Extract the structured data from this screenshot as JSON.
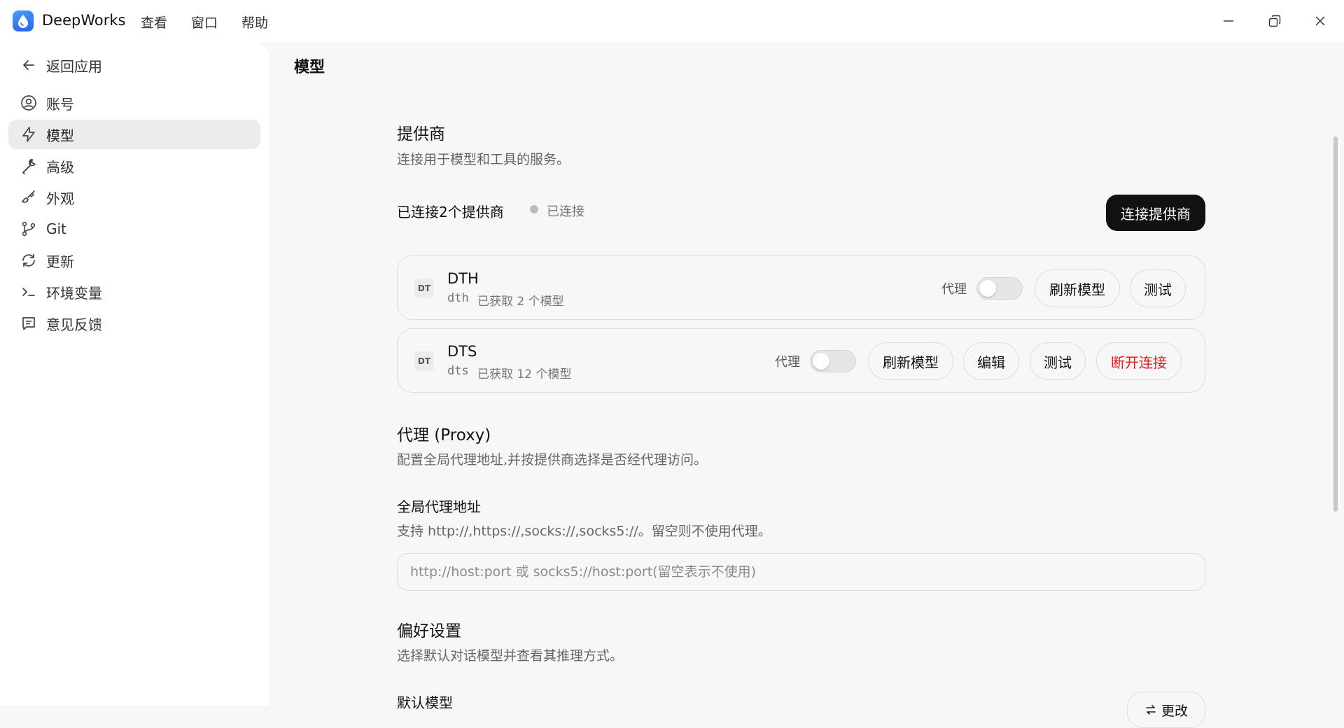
{
  "app": {
    "name": "DeepWorks",
    "menus": [
      "查看",
      "窗口",
      "帮助"
    ]
  },
  "sidebar": {
    "back_label": "返回应用",
    "items": [
      {
        "label": "账号",
        "icon": "user-circle-icon"
      },
      {
        "label": "模型",
        "icon": "lightning-icon",
        "active": true
      },
      {
        "label": "高级",
        "icon": "wrench-icon"
      },
      {
        "label": "外观",
        "icon": "brush-icon"
      },
      {
        "label": "Git",
        "icon": "git-branch-icon"
      },
      {
        "label": "更新",
        "icon": "refresh-icon"
      },
      {
        "label": "环境变量",
        "icon": "terminal-icon"
      },
      {
        "label": "意见反馈",
        "icon": "feedback-icon"
      }
    ]
  },
  "main": {
    "page_title": "模型",
    "providers": {
      "title": "提供商",
      "description": "连接用于模型和工具的服务。",
      "connected_count_label": "已连接2个提供商",
      "status_label": "已连接",
      "connect_button": "连接提供商",
      "list": [
        {
          "badge": "DT",
          "name": "DTH",
          "id": "dth",
          "models_info": "已获取 2 个模型",
          "proxy_label": "代理",
          "proxy_enabled": false,
          "buttons": [
            "刷新模型",
            "测试"
          ]
        },
        {
          "badge": "DT",
          "name": "DTS",
          "id": "dts",
          "models_info": "已获取 12 个模型",
          "proxy_label": "代理",
          "proxy_enabled": false,
          "buttons": [
            "刷新模型",
            "编辑",
            "测试",
            "断开连接"
          ]
        }
      ]
    },
    "proxy": {
      "title": "代理 (Proxy)",
      "description": "配置全局代理地址,并按提供商选择是否经代理访问。",
      "field_label": "全局代理地址",
      "field_hint": "支持 http://,https://,socks://,socks5://。留空则不使用代理。",
      "input_value": "",
      "input_placeholder": "http://host:port 或 socks5://host:port(留空表示不使用)"
    },
    "preferences": {
      "title": "偏好设置",
      "description": "选择默认对话模型并查看其推理方式。",
      "default_model_label": "默认模型",
      "change_button": "更改"
    }
  },
  "colors": {
    "primary_button": "#111111",
    "danger_text": "#e11d1d",
    "status_dot": "#bbbbbb",
    "logo": "#2563eb"
  }
}
